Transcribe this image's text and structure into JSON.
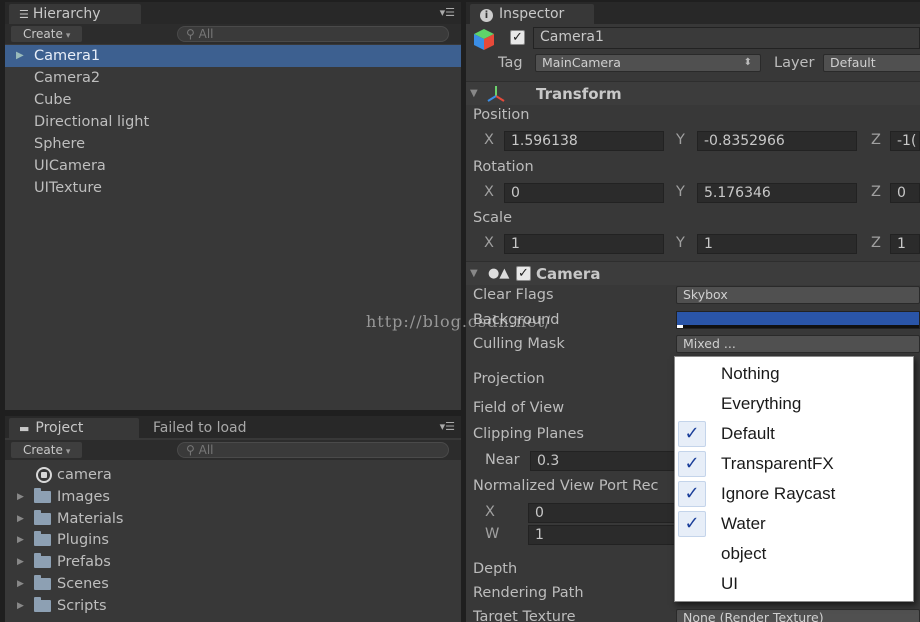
{
  "hierarchy": {
    "tab_label": "Hierarchy",
    "create_label": "Create",
    "search_placeholder": "All",
    "items": [
      "Camera1",
      "Camera2",
      "Cube",
      "Directional light",
      "Sphere",
      "UICamera",
      "UITexture"
    ]
  },
  "project": {
    "tab_label": "Project",
    "tab2_label": "Failed to load",
    "create_label": "Create",
    "search_placeholder": "All",
    "items": [
      "camera",
      "Images",
      "Materials",
      "Plugins",
      "Prefabs",
      "Scenes",
      "Scripts"
    ]
  },
  "inspector": {
    "tab_label": "Inspector",
    "object_name": "Camera1",
    "tag_label": "Tag",
    "tag_value": "MainCamera",
    "layer_label": "Layer",
    "layer_value": "Default",
    "transform": {
      "title": "Transform",
      "position_label": "Position",
      "rotation_label": "Rotation",
      "scale_label": "Scale",
      "x_label": "X",
      "y_label": "Y",
      "z_label": "Z",
      "position": {
        "x": "1.596138",
        "y": "-0.8352966",
        "z": "-1("
      },
      "rotation": {
        "x": "0",
        "y": "5.176346",
        "z": "0"
      },
      "scale": {
        "x": "1",
        "y": "1",
        "z": "1"
      }
    },
    "camera": {
      "title": "Camera",
      "clear_flags_label": "Clear Flags",
      "clear_flags_value": "Skybox",
      "background_label": "Background",
      "background_color": "#2a55a8",
      "culling_mask_label": "Culling Mask",
      "culling_mask_value": "Mixed ...",
      "projection_label": "Projection",
      "fov_label": "Field of View",
      "clipping_label": "Clipping Planes",
      "near_label": "Near",
      "near_value": "0.3",
      "viewport_label": "Normalized View Port Rec",
      "vp_x_label": "X",
      "vp_x_value": "0",
      "vp_w_label": "W",
      "vp_w_value": "1",
      "depth_label": "Depth",
      "rendering_path_label": "Rendering Path",
      "target_texture_label": "Target Texture",
      "target_texture_value": "None (Render Texture)"
    }
  },
  "culling_popup": {
    "options": [
      {
        "label": "Nothing",
        "checked": false
      },
      {
        "label": "Everything",
        "checked": false
      },
      {
        "label": "Default",
        "checked": true
      },
      {
        "label": "TransparentFX",
        "checked": true
      },
      {
        "label": "Ignore Raycast",
        "checked": true
      },
      {
        "label": "Water",
        "checked": true
      },
      {
        "label": "object",
        "checked": false
      },
      {
        "label": "UI",
        "checked": false
      }
    ]
  },
  "watermark": "http://blog.csdn.net/"
}
